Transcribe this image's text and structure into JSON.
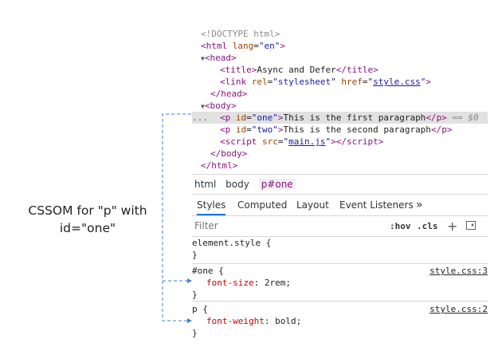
{
  "annotation": {
    "line1": "CSSOM  for \"p\" with",
    "line2": "id=\"one\""
  },
  "elements": {
    "doctype": "<!DOCTYPE html>",
    "html_open": {
      "tag": "html",
      "attr": "lang",
      "value": "en"
    },
    "head": "head",
    "title": {
      "tag": "title",
      "text": "Async and Defer"
    },
    "link": {
      "tag": "link",
      "attr1": "rel",
      "value1": "stylesheet",
      "attr2": "href",
      "value2": "style.css"
    },
    "body": "body",
    "p1": {
      "tag": "p",
      "attr": "id",
      "value": "one",
      "text": "This is the first paragraph",
      "marker": "== $0"
    },
    "p2": {
      "tag": "p",
      "attr": "id",
      "value": "two",
      "text": "This is the second paragraph"
    },
    "script": {
      "tag": "script",
      "attr": "src",
      "value": "main.js"
    },
    "dots": "..."
  },
  "breadcrumb": [
    "html",
    "body",
    "p#one"
  ],
  "tabs": [
    "Styles",
    "Computed",
    "Layout",
    "Event Listeners",
    "»"
  ],
  "filter": {
    "placeholder": "Filter",
    "hov": ":hov",
    "cls": ".cls",
    "plus": "+"
  },
  "styles": {
    "element_style": "element.style {",
    "close": "}",
    "rules": [
      {
        "selector": "#one {",
        "property": "font-size",
        "value": "2rem;",
        "source": "style.css:3"
      },
      {
        "selector": "p {",
        "property": "font-weight",
        "value": "bold;",
        "source": "style.css:2"
      }
    ]
  },
  "colors": {
    "accent": "#1a73e8",
    "connector": "#3d7fd6",
    "tag": "#881280",
    "attr": "#994500",
    "value": "#1a1aa6",
    "property": "#c80000"
  }
}
